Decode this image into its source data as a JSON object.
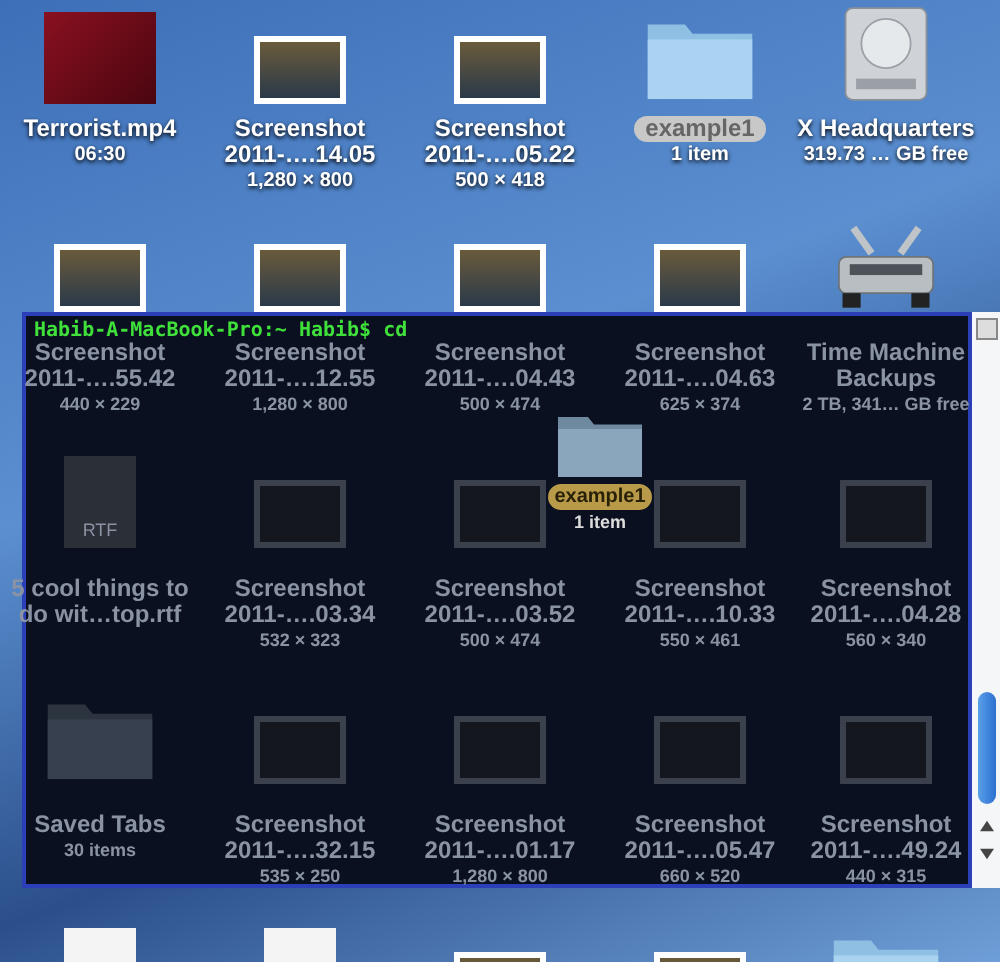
{
  "desktop_items": [
    {
      "kind": "video",
      "title": [
        "Terrorist.mp4"
      ],
      "info": [
        "06:30"
      ],
      "selected": false
    },
    {
      "kind": "screenshot",
      "title": [
        "Screenshot",
        "2011-….14.05"
      ],
      "info": [
        "1,280 × 800"
      ],
      "selected": false
    },
    {
      "kind": "screenshot",
      "title": [
        "Screenshot",
        "2011-….05.22"
      ],
      "info": [
        "500 × 418"
      ],
      "selected": false
    },
    {
      "kind": "folder",
      "title": [
        "example1"
      ],
      "info": [
        "1 item"
      ],
      "selected": true
    },
    {
      "kind": "drive",
      "title": [
        "X Headquarters"
      ],
      "info": [
        "319.73 … GB free"
      ],
      "selected": false
    },
    {
      "kind": "screenshot",
      "title": [
        "Screenshot",
        "2011-….55.42"
      ],
      "info": [
        "440 × 229"
      ],
      "selected": false
    },
    {
      "kind": "screenshot",
      "title": [
        "Screenshot",
        "2011-….12.55"
      ],
      "info": [
        "1,280 × 800"
      ],
      "selected": false
    },
    {
      "kind": "screenshot",
      "title": [
        "Screenshot",
        "2011-….04.43"
      ],
      "info": [
        "500 × 474"
      ],
      "selected": false
    },
    {
      "kind": "screenshot",
      "title": [
        "Screenshot",
        "2011-….04.63"
      ],
      "info": [
        "625 × 374"
      ],
      "selected": false
    },
    {
      "kind": "timemachine",
      "title": [
        "Time Machine",
        "Backups"
      ],
      "info": [
        "2 TB, 341… GB free"
      ],
      "selected": false
    },
    {
      "kind": "rtf",
      "badge": "RTF",
      "title": [
        "5 cool things to",
        "do wit…top.rtf"
      ],
      "selected": false
    },
    {
      "kind": "screenshot",
      "title": [
        "Screenshot",
        "2011-….03.34"
      ],
      "info": [
        "532 × 323"
      ],
      "selected": false
    },
    {
      "kind": "screenshot",
      "title": [
        "Screenshot",
        "2011-….03.52"
      ],
      "info": [
        "500 × 474"
      ],
      "selected": false
    },
    {
      "kind": "screenshot",
      "title": [
        "Screenshot",
        "2011-….10.33"
      ],
      "info": [
        "550 × 461"
      ],
      "selected": false
    },
    {
      "kind": "screenshot",
      "title": [
        "Screenshot",
        "2011-….04.28"
      ],
      "info": [
        "560 × 340"
      ],
      "selected": false
    },
    {
      "kind": "folder",
      "title": [
        "Saved Tabs"
      ],
      "info": [
        "30 items"
      ],
      "selected": false
    },
    {
      "kind": "screenshot",
      "title": [
        "Screenshot",
        "2011-….32.15"
      ],
      "info": [
        "535 × 250"
      ],
      "selected": false
    },
    {
      "kind": "screenshot",
      "title": [
        "Screenshot",
        "2011-….01.17"
      ],
      "info": [
        "1,280 × 800"
      ],
      "selected": false
    },
    {
      "kind": "screenshot",
      "title": [
        "Screenshot",
        "2011-….05.47"
      ],
      "info": [
        "660 × 520"
      ],
      "selected": false
    },
    {
      "kind": "screenshot",
      "title": [
        "Screenshot",
        "2011-….49.24"
      ],
      "info": [
        "440 × 315"
      ],
      "selected": false
    },
    {
      "kind": "document",
      "selected": false
    },
    {
      "kind": "document",
      "selected": false
    },
    {
      "kind": "screenshot",
      "selected": false
    },
    {
      "kind": "screenshot",
      "selected": false
    },
    {
      "kind": "folder",
      "selected": false
    }
  ],
  "terminal": {
    "prompt": "Habib-A-MacBook-Pro:~ Habib$ cd"
  },
  "drag_ghost": {
    "title": "example1",
    "info": "1 item"
  }
}
